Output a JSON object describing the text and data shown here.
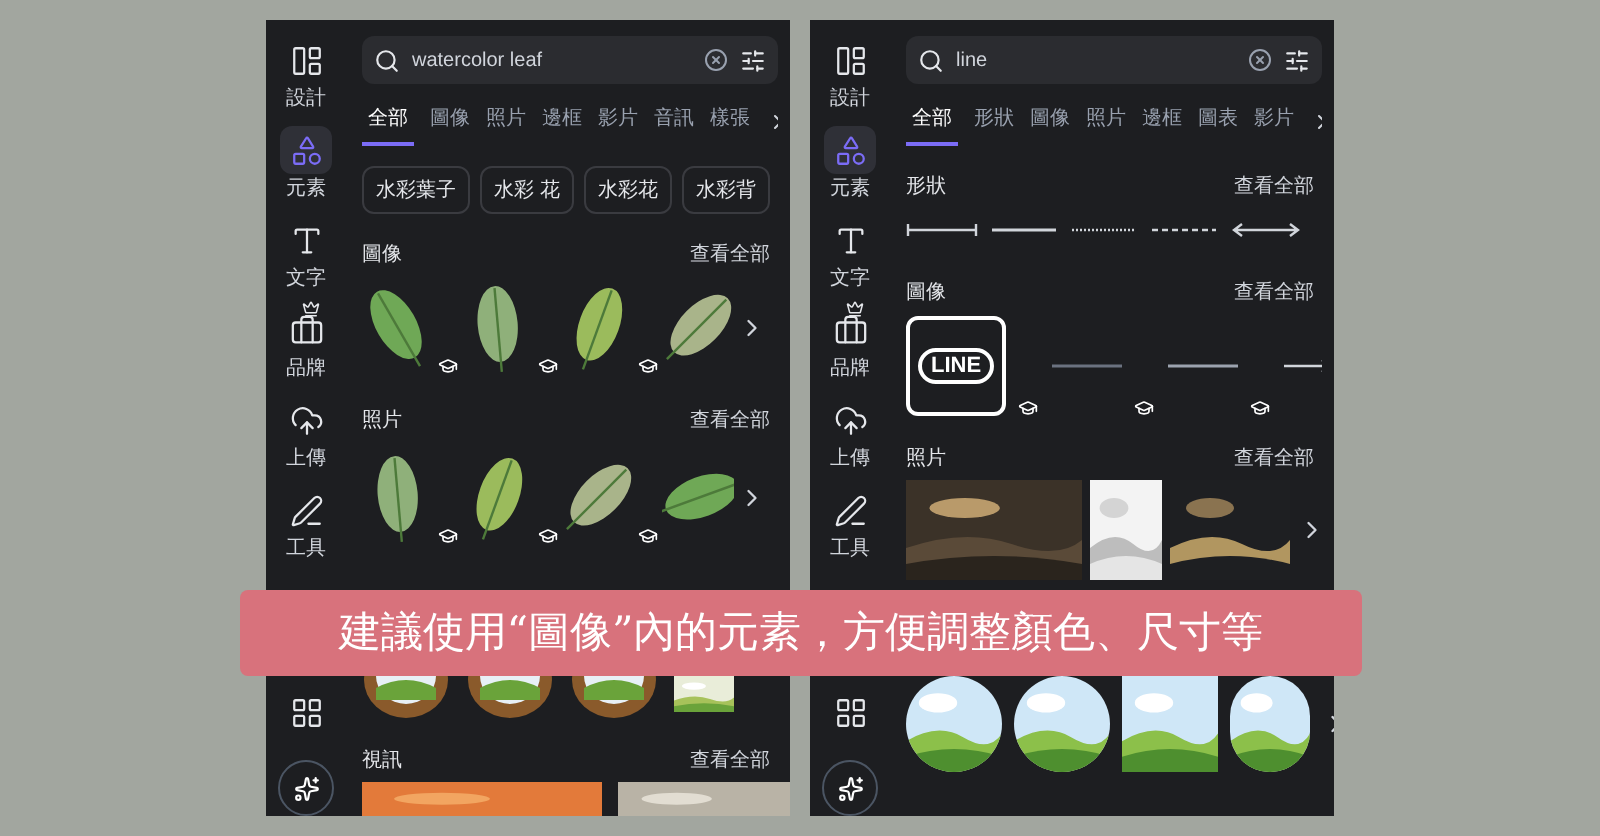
{
  "panels": [
    {
      "sidebar": [
        {
          "kind": "design",
          "label": "設計",
          "selected": false
        },
        {
          "kind": "elements",
          "label": "元素",
          "selected": true
        },
        {
          "kind": "text",
          "label": "文字",
          "selected": false
        },
        {
          "kind": "brand",
          "label": "品牌",
          "selected": false
        },
        {
          "kind": "upload",
          "label": "上傳",
          "selected": false
        },
        {
          "kind": "tools",
          "label": "工具",
          "selected": false
        },
        {
          "kind": "apps",
          "selected": false
        }
      ],
      "search": {
        "value": "watercolor leaf"
      },
      "tabs": [
        {
          "label": "全部",
          "selected": true
        },
        {
          "label": "圖像",
          "selected": false
        },
        {
          "label": "照片",
          "selected": false
        },
        {
          "label": "邊框",
          "selected": false
        },
        {
          "label": "影片",
          "selected": false
        },
        {
          "label": "音訊",
          "selected": false
        },
        {
          "label": "樣張",
          "selected": false
        }
      ],
      "chips": [
        "水彩葉子",
        "水彩 花",
        "水彩花",
        "水彩背"
      ],
      "sections": [
        {
          "kind": "leaves",
          "title": "圖像",
          "link": "查看全部"
        },
        {
          "kind": "leaf-photos",
          "title": "照片",
          "link": "查看全部"
        },
        {
          "kind": "frames"
        },
        {
          "kind": "videos",
          "title": "視訊",
          "link": "查看全部"
        }
      ]
    },
    {
      "sidebar": [
        {
          "kind": "design",
          "label": "設計",
          "selected": false
        },
        {
          "kind": "elements",
          "label": "元素",
          "selected": true
        },
        {
          "kind": "text",
          "label": "文字",
          "selected": false
        },
        {
          "kind": "brand",
          "label": "品牌",
          "selected": false
        },
        {
          "kind": "upload",
          "label": "上傳",
          "selected": false
        },
        {
          "kind": "tools",
          "label": "工具",
          "selected": false
        },
        {
          "kind": "apps",
          "selected": false
        }
      ],
      "search": {
        "value": "line"
      },
      "tabs": [
        {
          "label": "全部",
          "selected": true
        },
        {
          "label": "形狀",
          "selected": false
        },
        {
          "label": "圖像",
          "selected": false
        },
        {
          "label": "照片",
          "selected": false
        },
        {
          "label": "邊框",
          "selected": false
        },
        {
          "label": "圖表",
          "selected": false
        },
        {
          "label": "影片",
          "selected": false
        }
      ],
      "sections": [
        {
          "kind": "shapes",
          "title": "形狀",
          "link": "查看全部"
        },
        {
          "kind": "line-art",
          "title": "圖像",
          "link": "查看全部",
          "logo_text": "LINE"
        },
        {
          "kind": "photos",
          "title": "照片",
          "link": "查看全部"
        },
        {
          "kind": "circles"
        }
      ]
    }
  ],
  "banner": "建議使用“圖像”內的元素，方便調整顏色、尺寸等"
}
